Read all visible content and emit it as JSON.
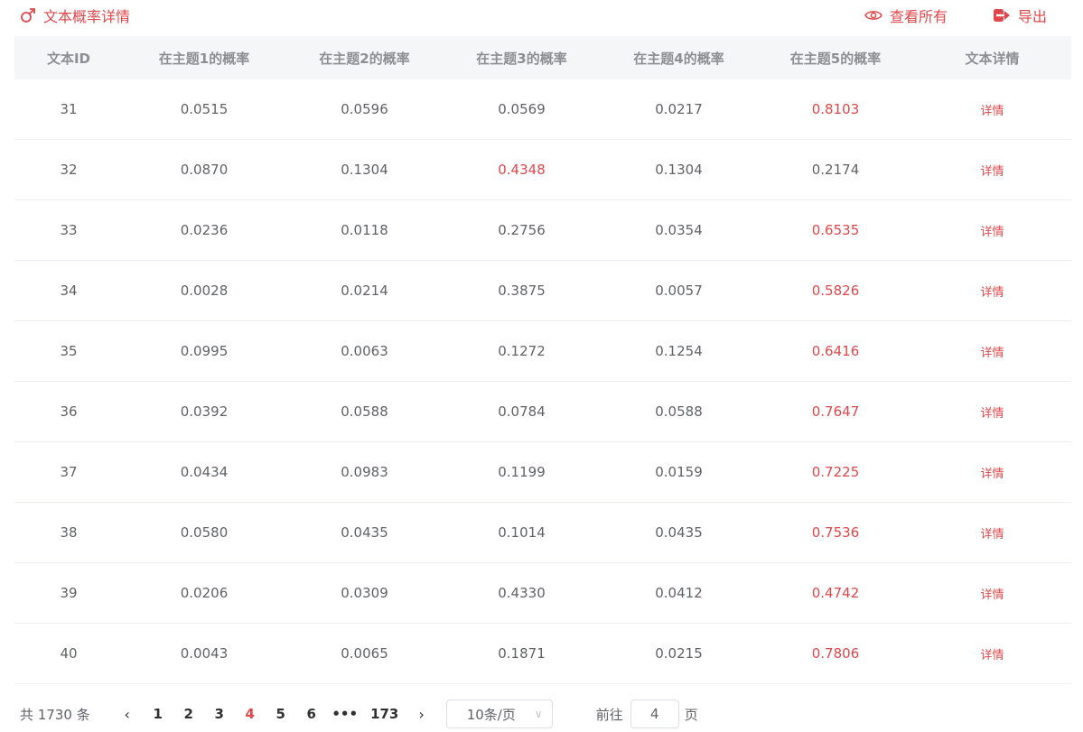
{
  "header": {
    "title": "文本概率详情",
    "view_all_label": "查看所有",
    "export_label": "导出"
  },
  "colors": {
    "accent": "#e0474a",
    "text": "#606266",
    "header_bg": "#f5f6f8"
  },
  "table": {
    "columns": [
      "文本ID",
      "在主题1的概率",
      "在主题2的概率",
      "在主题3的概率",
      "在主题4的概率",
      "在主题5的概率",
      "文本详情"
    ],
    "detail_label": "详情",
    "rows": [
      {
        "id": "31",
        "p": [
          "0.0515",
          "0.0596",
          "0.0569",
          "0.0217",
          "0.8103"
        ],
        "max": 4
      },
      {
        "id": "32",
        "p": [
          "0.0870",
          "0.1304",
          "0.4348",
          "0.1304",
          "0.2174"
        ],
        "max": 2
      },
      {
        "id": "33",
        "p": [
          "0.0236",
          "0.0118",
          "0.2756",
          "0.0354",
          "0.6535"
        ],
        "max": 4
      },
      {
        "id": "34",
        "p": [
          "0.0028",
          "0.0214",
          "0.3875",
          "0.0057",
          "0.5826"
        ],
        "max": 4
      },
      {
        "id": "35",
        "p": [
          "0.0995",
          "0.0063",
          "0.1272",
          "0.1254",
          "0.6416"
        ],
        "max": 4
      },
      {
        "id": "36",
        "p": [
          "0.0392",
          "0.0588",
          "0.0784",
          "0.0588",
          "0.7647"
        ],
        "max": 4
      },
      {
        "id": "37",
        "p": [
          "0.0434",
          "0.0983",
          "0.1199",
          "0.0159",
          "0.7225"
        ],
        "max": 4
      },
      {
        "id": "38",
        "p": [
          "0.0580",
          "0.0435",
          "0.1014",
          "0.0435",
          "0.7536"
        ],
        "max": 4
      },
      {
        "id": "39",
        "p": [
          "0.0206",
          "0.0309",
          "0.4330",
          "0.0412",
          "0.4742"
        ],
        "max": 4
      },
      {
        "id": "40",
        "p": [
          "0.0043",
          "0.0065",
          "0.1871",
          "0.0215",
          "0.7806"
        ],
        "max": 4
      }
    ]
  },
  "pagination": {
    "total_text": "共 1730 条",
    "pages": [
      "1",
      "2",
      "3",
      "4",
      "5",
      "6"
    ],
    "current": "4",
    "more": "•••",
    "last": "173",
    "page_size": "10条/页",
    "goto_prefix": "前往",
    "goto_value": "4",
    "goto_suffix": "页"
  }
}
